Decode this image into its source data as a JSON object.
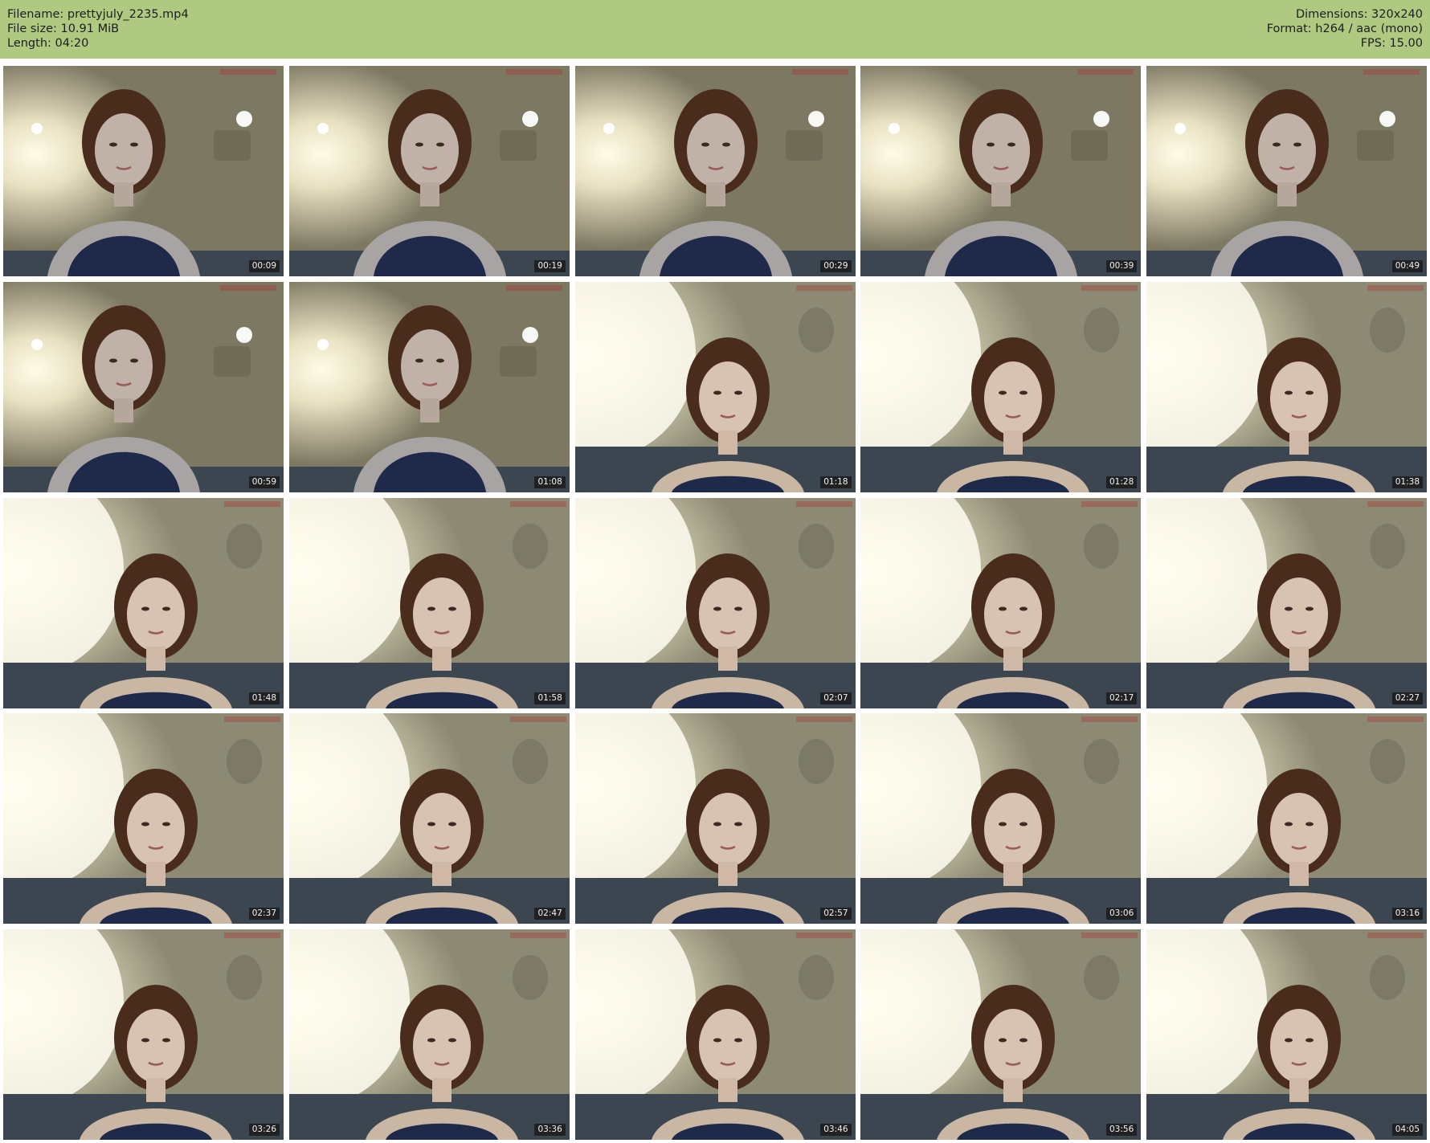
{
  "header": {
    "filename": "Filename: prettyjuly_2235.mp4",
    "file_size": "File size: 10.91 MiB",
    "length": "Length: 04:20",
    "dimensions": "Dimensions: 320x240",
    "format": "Format: h264 / aac (mono)",
    "fps": "FPS: 15.00",
    "background_color": "#afca80"
  },
  "thumbnails": [
    {
      "time": "00:09"
    },
    {
      "time": "00:19"
    },
    {
      "time": "00:29"
    },
    {
      "time": "00:39"
    },
    {
      "time": "00:49"
    },
    {
      "time": "00:59"
    },
    {
      "time": "01:08"
    },
    {
      "time": "01:18"
    },
    {
      "time": "01:28"
    },
    {
      "time": "01:38"
    },
    {
      "time": "01:48"
    },
    {
      "time": "01:58"
    },
    {
      "time": "02:07"
    },
    {
      "time": "02:17"
    },
    {
      "time": "02:27"
    },
    {
      "time": "02:37"
    },
    {
      "time": "02:47"
    },
    {
      "time": "02:57"
    },
    {
      "time": "03:06"
    },
    {
      "time": "03:16"
    },
    {
      "time": "03:26"
    },
    {
      "time": "03:36"
    },
    {
      "time": "03:46"
    },
    {
      "time": "03:56"
    },
    {
      "time": "04:05"
    }
  ]
}
